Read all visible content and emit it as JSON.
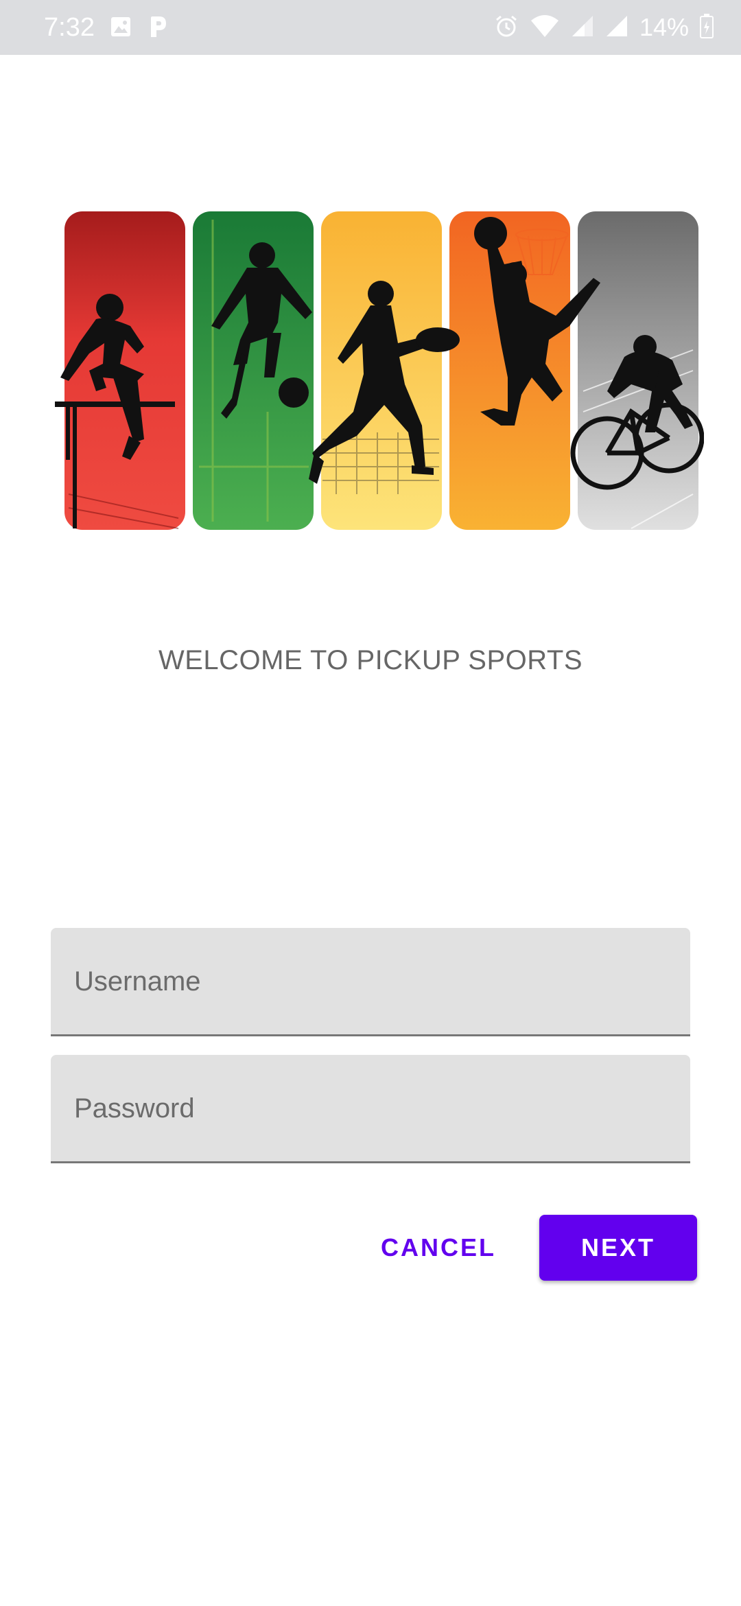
{
  "status_bar": {
    "time": "7:32",
    "battery": "14%",
    "icons": [
      "image-icon",
      "p-app-icon",
      "alarm-icon",
      "wifi-icon",
      "signal-icon",
      "signal-icon",
      "battery-icon"
    ]
  },
  "hero": {
    "panels": [
      {
        "name": "hurdles",
        "color": "#e53935"
      },
      {
        "name": "soccer",
        "color": "#2e8b3a"
      },
      {
        "name": "football",
        "color": "#f9c74f"
      },
      {
        "name": "basketball",
        "color": "#f57c28"
      },
      {
        "name": "cycling",
        "color": "#9e9e9e"
      }
    ]
  },
  "welcome": {
    "text": "WELCOME TO PICKUP SPORTS"
  },
  "form": {
    "username_placeholder": "Username",
    "password_placeholder": "Password",
    "cancel_label": "CANCEL",
    "next_label": "NEXT"
  },
  "colors": {
    "accent": "#6200ee",
    "status_bar_bg": "#dcdde0",
    "field_bg": "#e1e1e1"
  }
}
